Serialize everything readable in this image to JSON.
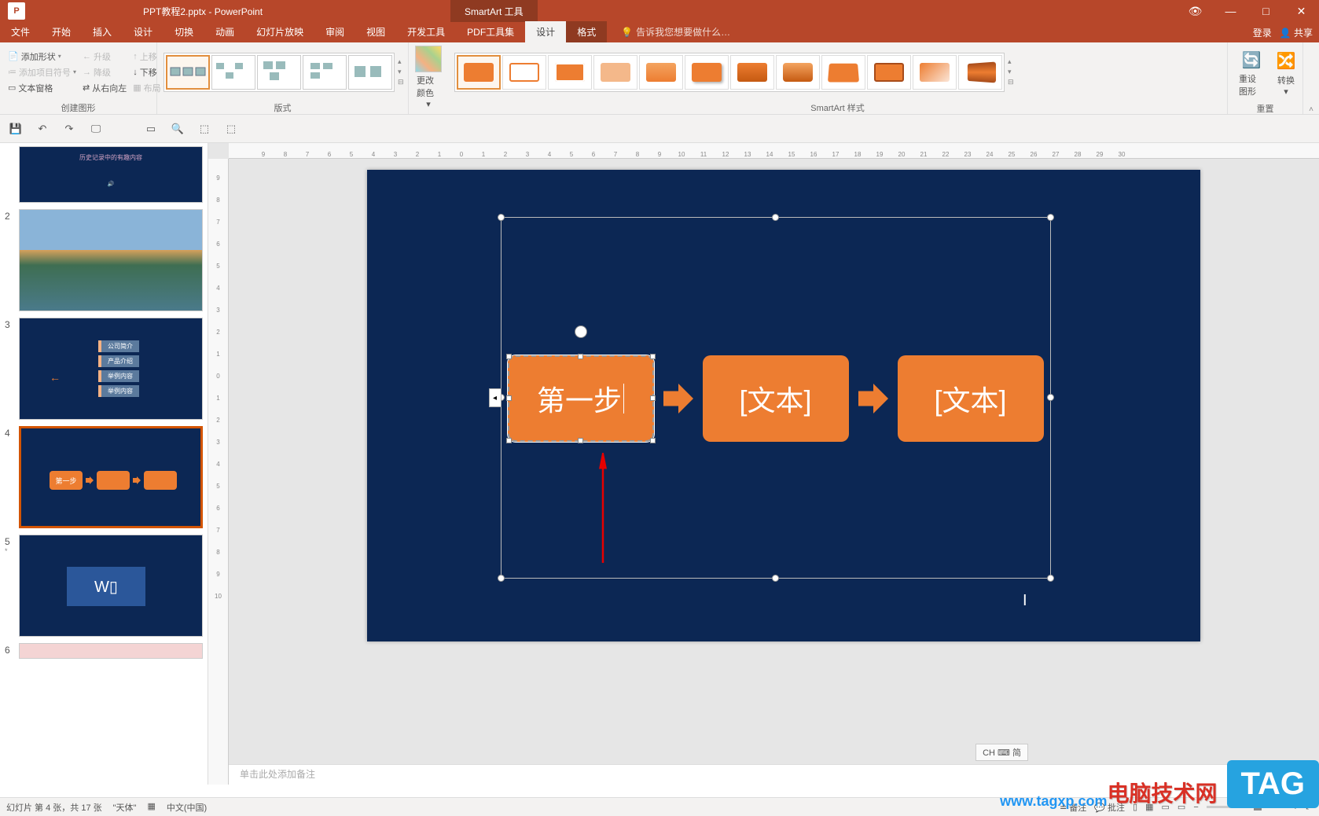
{
  "titlebar": {
    "title": "PPT教程2.pptx - PowerPoint",
    "context_tool": "SmartArt 工具"
  },
  "window_controls": {
    "eye": "👁",
    "min": "—",
    "max": "□",
    "close": "✕"
  },
  "menu": {
    "tabs": [
      "文件",
      "开始",
      "插入",
      "设计",
      "切换",
      "动画",
      "幻灯片放映",
      "审阅",
      "视图",
      "开发工具",
      "PDF工具集"
    ],
    "context_tabs": [
      "设计",
      "格式"
    ],
    "active_context": "设计",
    "tell_me": "告诉我您想要做什么…",
    "right": {
      "login": "登录",
      "share": "共享"
    }
  },
  "ribbon": {
    "create_group": {
      "add_shape": "添加形状",
      "add_bullet": "添加项目符号",
      "text_pane": "文本窗格",
      "promote": "升级",
      "demote": "降级",
      "rtl": "从右向左",
      "up": "上移",
      "down": "下移",
      "layout": "布局",
      "label": "创建图形"
    },
    "layouts_label": "版式",
    "change_colors": "更改颜色",
    "styles_label": "SmartArt 样式",
    "reset_group": {
      "reset": "重设图形",
      "convert": "转换",
      "label": "重置"
    }
  },
  "ruler_h": [
    "9",
    "8",
    "7",
    "6",
    "5",
    "4",
    "3",
    "2",
    "1",
    "0",
    "1",
    "2",
    "3",
    "4",
    "5",
    "6",
    "7",
    "8",
    "9",
    "10",
    "11",
    "12",
    "13",
    "14",
    "15",
    "16",
    "17",
    "18",
    "19",
    "20",
    "21",
    "22",
    "23",
    "24",
    "25",
    "26",
    "27",
    "28",
    "29",
    "30"
  ],
  "ruler_v": [
    "9",
    "8",
    "7",
    "6",
    "5",
    "4",
    "3",
    "2",
    "1",
    "0",
    "1",
    "2",
    "3",
    "4",
    "5",
    "6",
    "7",
    "8",
    "9",
    "10"
  ],
  "slides": {
    "s3_items": [
      "公司简介",
      "产品介绍",
      "举例内容",
      "举例内容"
    ],
    "s4_box1": "第一步"
  },
  "smartart": {
    "box1": "第一步",
    "box2": "[文本]",
    "box3": "[文本]"
  },
  "notes_placeholder": "单击此处添加备注",
  "ime": "CH ⌨ 简",
  "statusbar": {
    "slide_info": "幻灯片 第 4 张，共 17 张",
    "theme": "\"天体\"",
    "lang": "中文(中国)",
    "notes": "备注",
    "comments": "批注",
    "zoom": "+"
  },
  "watermark": {
    "name": "电脑技术网",
    "url": "www.tagxp.com",
    "tag": "TAG"
  }
}
